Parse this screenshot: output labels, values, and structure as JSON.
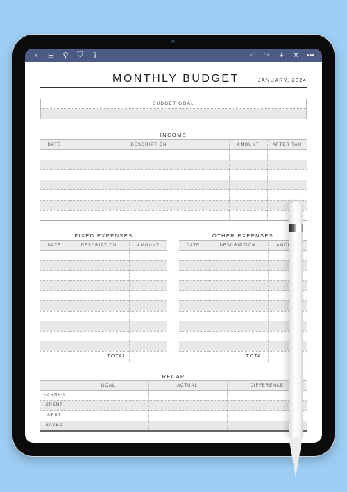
{
  "toolbar": {
    "left_icons": [
      {
        "name": "back-icon",
        "glyph": "‹"
      },
      {
        "name": "grid-icon",
        "glyph": "⊞"
      },
      {
        "name": "search-icon",
        "glyph": "⚲"
      },
      {
        "name": "bookmark-icon",
        "glyph": "⛉"
      },
      {
        "name": "share-icon",
        "glyph": "⇪"
      }
    ],
    "right_icons": [
      {
        "name": "undo-icon",
        "glyph": "↶",
        "dim": true
      },
      {
        "name": "redo-icon",
        "glyph": "↷",
        "dim": true
      },
      {
        "name": "add-icon",
        "glyph": "+",
        "dim": false
      },
      {
        "name": "tools-icon",
        "glyph": "✕",
        "dim": false
      },
      {
        "name": "more-icon",
        "glyph": "•••",
        "dim": false
      }
    ]
  },
  "page": {
    "title": "MONTHLY BUDGET",
    "date": "JANUARY, 2024",
    "budget_goal": {
      "label": "BUDGET GOAL",
      "value": ""
    },
    "income": {
      "title": "INCOME",
      "columns": [
        "DATE",
        "DESCRIPTION",
        "AMOUNT",
        "AFTER TAX"
      ],
      "row_count": 7
    },
    "fixed_expenses": {
      "title": "FIXED EXPENSES",
      "columns": [
        "DATE",
        "DESCRIPTION",
        "AMOUNT"
      ],
      "row_count": 10,
      "total_label": "TOTAL"
    },
    "other_expenses": {
      "title": "OTHER EXPENSES",
      "columns": [
        "DATE",
        "DESCRIPTION",
        "AMOUNT"
      ],
      "row_count": 10,
      "total_label": "TOTAL"
    },
    "recap": {
      "title": "RECAP",
      "columns": [
        "",
        "GOAL",
        "ACTUAL",
        "DIFFERENCE"
      ],
      "rows": [
        "EARNED",
        "SPENT",
        "DEBT",
        "SAVED"
      ]
    }
  }
}
